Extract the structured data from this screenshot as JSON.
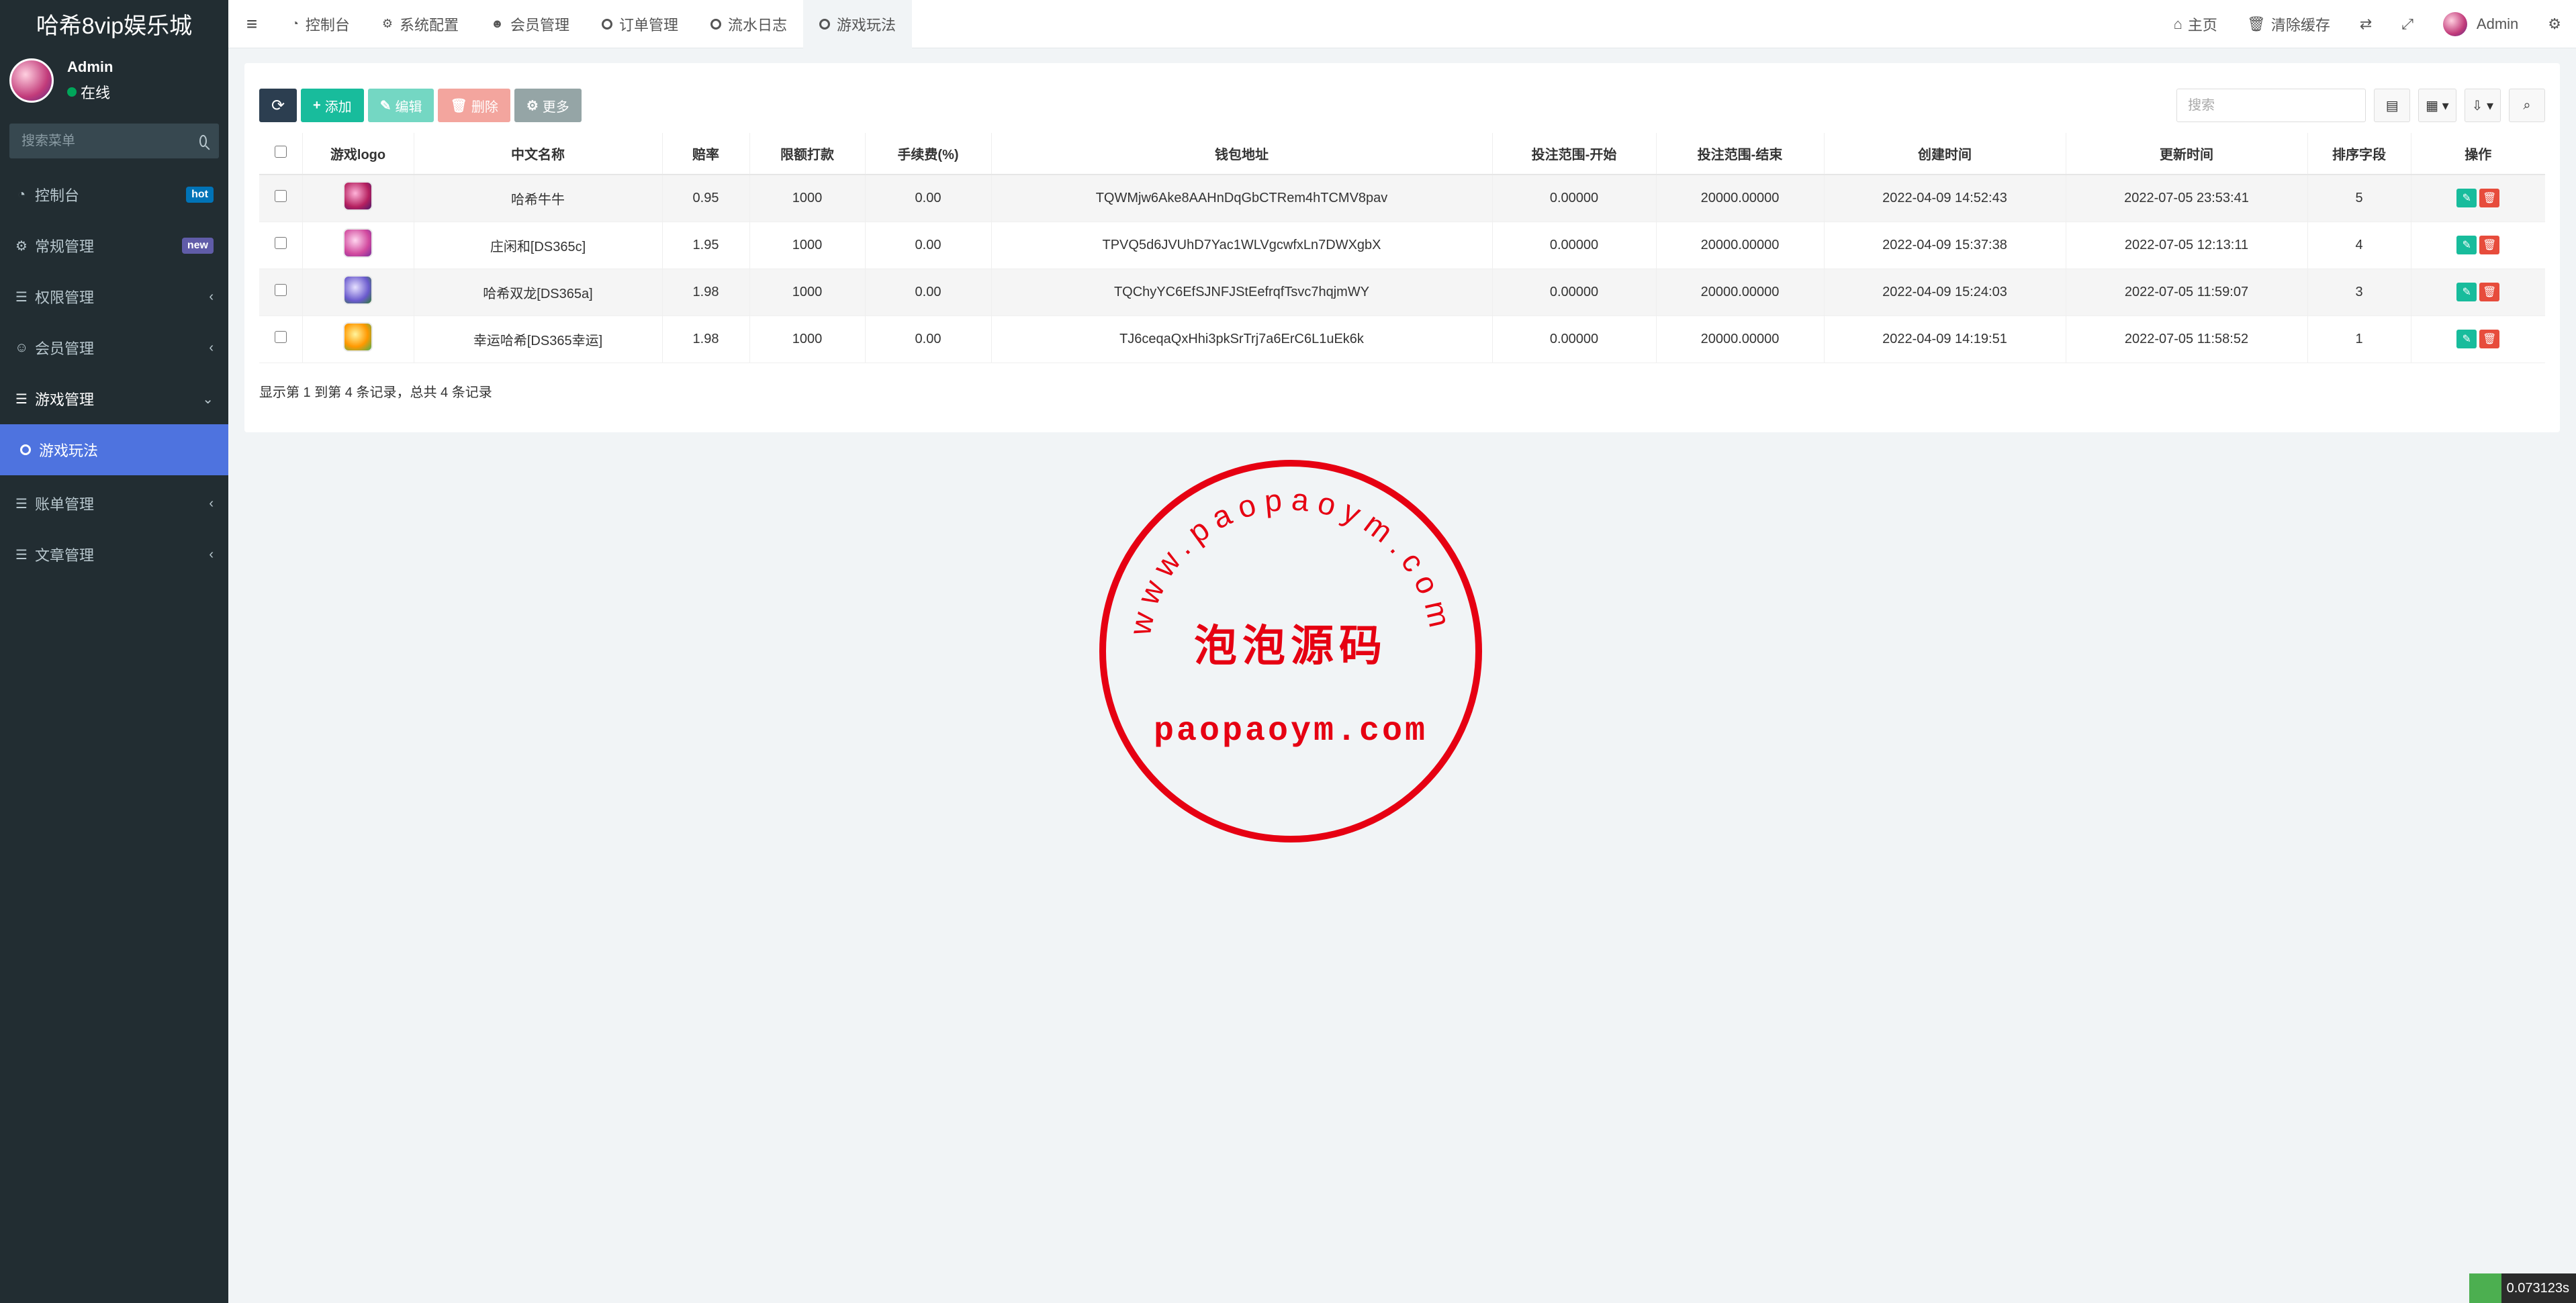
{
  "sidebar": {
    "logo": "哈希8vip娱乐城",
    "user": {
      "name": "Admin",
      "status": "在线"
    },
    "search_placeholder": "搜索菜单",
    "menu": [
      {
        "label": "控制台",
        "badge": "hot"
      },
      {
        "label": "常规管理",
        "badge": "new"
      },
      {
        "label": "权限管理",
        "chev": "‹"
      },
      {
        "label": "会员管理",
        "chev": "‹"
      },
      {
        "label": "游戏管理",
        "chev": "⌄"
      },
      {
        "label": "账单管理",
        "chev": "‹"
      },
      {
        "label": "文章管理",
        "chev": "‹"
      }
    ],
    "submenu_active": "游戏玩法"
  },
  "topnav": {
    "tabs": [
      "控制台",
      "系统配置",
      "会员管理",
      "订单管理",
      "流水日志",
      "游戏玩法"
    ],
    "right": {
      "home": "主页",
      "clear_cache": "清除缓存",
      "user": "Admin"
    }
  },
  "toolbar": {
    "add": "添加",
    "edit": "编辑",
    "delete": "删除",
    "more": "更多",
    "search_placeholder": "搜索"
  },
  "table": {
    "headers": [
      "游戏logo",
      "中文名称",
      "赔率",
      "限额打款",
      "手续费(%)",
      "钱包地址",
      "投注范围-开始",
      "投注范围-结束",
      "创建时间",
      "更新时间",
      "排序字段",
      "操作"
    ],
    "rows": [
      {
        "name": "哈希牛牛",
        "odds": "0.95",
        "limit": "1000",
        "fee": "0.00",
        "wallet": "TQWMjw6Ake8AAHnDqGbCTRem4hTCMV8pav",
        "start": "0.00000",
        "end": "20000.00000",
        "created": "2022-04-09 14:52:43",
        "updated": "2022-07-05 23:53:41",
        "sort": "5"
      },
      {
        "name": "庄闲和[DS365c]",
        "odds": "1.95",
        "limit": "1000",
        "fee": "0.00",
        "wallet": "TPVQ5d6JVUhD7Yac1WLVgcwfxLn7DWXgbX",
        "start": "0.00000",
        "end": "20000.00000",
        "created": "2022-04-09 15:37:38",
        "updated": "2022-07-05 12:13:11",
        "sort": "4"
      },
      {
        "name": "哈希双龙[DS365a]",
        "odds": "1.98",
        "limit": "1000",
        "fee": "0.00",
        "wallet": "TQChyYC6EfSJNFJStEefrqfTsvc7hqjmWY",
        "start": "0.00000",
        "end": "20000.00000",
        "created": "2022-04-09 15:24:03",
        "updated": "2022-07-05 11:59:07",
        "sort": "3"
      },
      {
        "name": "幸运哈希[DS365幸运]",
        "odds": "1.98",
        "limit": "1000",
        "fee": "0.00",
        "wallet": "TJ6ceqaQxHhi3pkSrTrj7a6ErC6L1uEk6k",
        "start": "0.00000",
        "end": "20000.00000",
        "created": "2022-04-09 14:19:51",
        "updated": "2022-07-05 11:58:52",
        "sort": "1"
      }
    ],
    "summary": "显示第 1 到第 4 条记录，总共 4 条记录"
  },
  "stamp": {
    "arc_text": "www.paopaoym.com",
    "center": "泡泡源码",
    "bottom": "paopaoym.com"
  },
  "timer": "0.073123s",
  "colors": {
    "sidebar": "#222d32",
    "active": "#4e73df",
    "add": "#18bc9c",
    "delete": "#e74c3c",
    "stamp": "#e60012"
  }
}
